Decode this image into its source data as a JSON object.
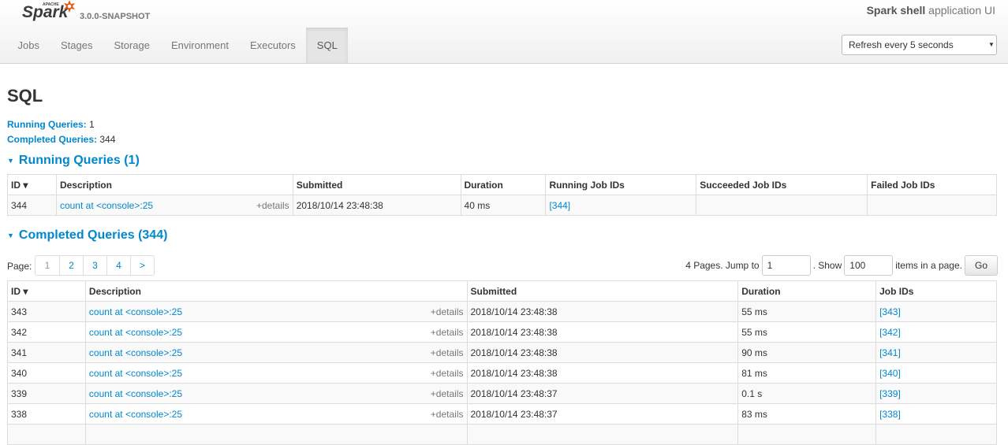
{
  "brand": {
    "logo_text": "Spark",
    "logo_small": "APACHE",
    "version": "3.0.0-SNAPSHOT"
  },
  "app_title": {
    "name": "Spark shell",
    "suffix": "application UI"
  },
  "tabs": [
    {
      "label": "Jobs",
      "active": false
    },
    {
      "label": "Stages",
      "active": false
    },
    {
      "label": "Storage",
      "active": false
    },
    {
      "label": "Environment",
      "active": false
    },
    {
      "label": "Executors",
      "active": false
    },
    {
      "label": "SQL",
      "active": true
    }
  ],
  "refresh": {
    "selected": "Refresh every 5 seconds"
  },
  "page": {
    "title": "SQL"
  },
  "summary": {
    "running_label": "Running Queries:",
    "running_value": "1",
    "completed_label": "Completed Queries:",
    "completed_value": "344"
  },
  "running": {
    "heading": "Running Queries (1)",
    "headers": [
      "ID ▾",
      "Description",
      "Submitted",
      "Duration",
      "Running Job IDs",
      "Succeeded Job IDs",
      "Failed Job IDs"
    ],
    "rows": [
      {
        "id": "344",
        "desc": "count at <console>:25",
        "details": "+details",
        "submitted": "2018/10/14 23:48:38",
        "duration": "40 ms",
        "running_jobs": "[344]",
        "succeeded_jobs": "",
        "failed_jobs": ""
      }
    ]
  },
  "completed": {
    "heading": "Completed Queries (344)",
    "pager_label": "Page:",
    "pages": [
      "1",
      "2",
      "3",
      "4",
      ">"
    ],
    "jump_text": "4 Pages. Jump to",
    "jump_value": "1",
    "show_text": ". Show",
    "show_value": "100",
    "items_text": "items in a page.",
    "go_label": "Go",
    "headers": [
      "ID ▾",
      "Description",
      "Submitted",
      "Duration",
      "Job IDs"
    ],
    "rows": [
      {
        "id": "343",
        "desc": "count at <console>:25",
        "details": "+details",
        "submitted": "2018/10/14 23:48:38",
        "duration": "55 ms",
        "jobs": "[343]"
      },
      {
        "id": "342",
        "desc": "count at <console>:25",
        "details": "+details",
        "submitted": "2018/10/14 23:48:38",
        "duration": "55 ms",
        "jobs": "[342]"
      },
      {
        "id": "341",
        "desc": "count at <console>:25",
        "details": "+details",
        "submitted": "2018/10/14 23:48:38",
        "duration": "90 ms",
        "jobs": "[341]"
      },
      {
        "id": "340",
        "desc": "count at <console>:25",
        "details": "+details",
        "submitted": "2018/10/14 23:48:38",
        "duration": "81 ms",
        "jobs": "[340]"
      },
      {
        "id": "339",
        "desc": "count at <console>:25",
        "details": "+details",
        "submitted": "2018/10/14 23:48:37",
        "duration": "0.1 s",
        "jobs": "[339]"
      },
      {
        "id": "338",
        "desc": "count at <console>:25",
        "details": "+details",
        "submitted": "2018/10/14 23:48:37",
        "duration": "83 ms",
        "jobs": "[338]"
      },
      {
        "id": "",
        "desc": "",
        "details": "",
        "submitted": "",
        "duration": "",
        "jobs": ""
      }
    ]
  },
  "colors": {
    "link": "#0088cc",
    "muted": "#777777",
    "logo_orange": "#e25a1c"
  }
}
